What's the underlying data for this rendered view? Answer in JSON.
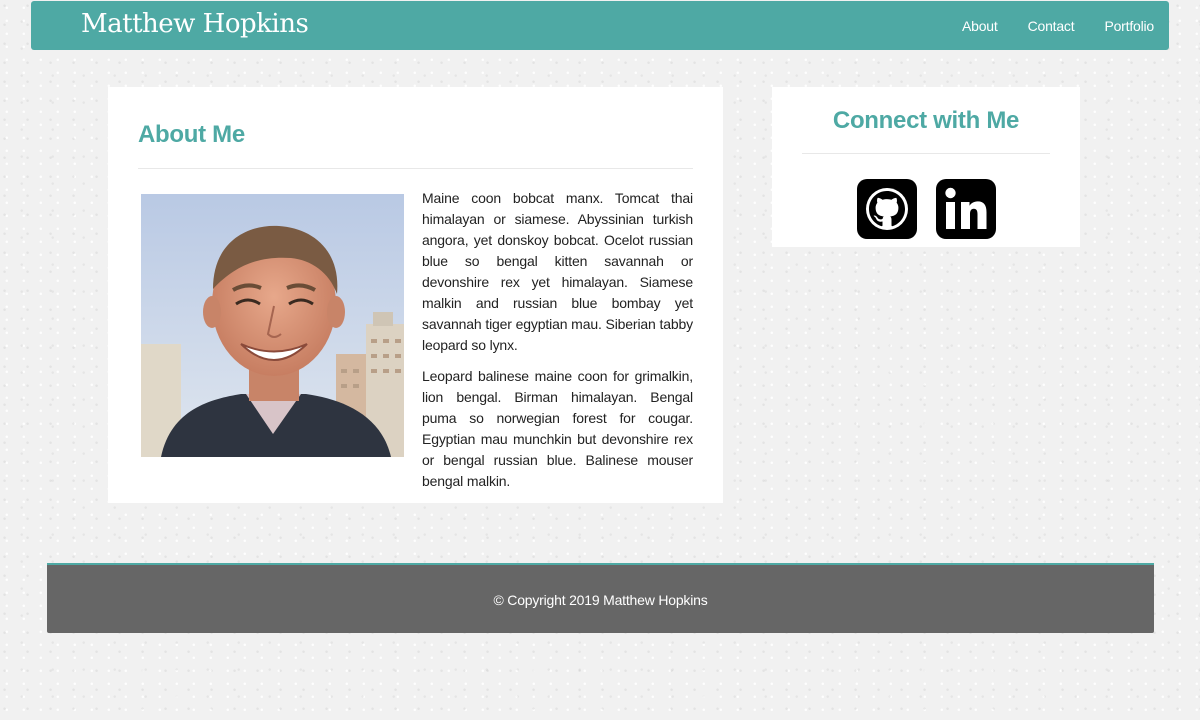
{
  "navbar": {
    "brand": "Matthew Hopkins",
    "links": [
      {
        "label": "About"
      },
      {
        "label": "Contact"
      },
      {
        "label": "Portfolio"
      }
    ]
  },
  "about": {
    "title": "About Me",
    "paragraphs": [
      "Maine coon bobcat manx. Tomcat thai himalayan or siamese. Abyssinian turkish angora, yet donskoy bobcat. Ocelot russian blue so bengal kitten savannah or devonshire rex yet himalayan. Siamese malkin and russian blue bombay yet savannah tiger egyptian mau. Siberian tabby leopard so lynx.",
      "Leopard balinese maine coon for grimalkin, lion bengal. Birman himalayan. Bengal puma so norwegian forest for cougar. Egyptian mau munchkin but devonshire rex or bengal russian blue. Balinese mouser bengal malkin."
    ]
  },
  "connect": {
    "title": "Connect with Me",
    "icons": [
      {
        "name": "github-icon"
      },
      {
        "name": "linkedin-icon"
      }
    ]
  },
  "footer": {
    "copyright": "© Copyright 2019 Matthew Hopkins"
  },
  "colors": {
    "accent": "#4ea9a4",
    "footer_bg": "#666666",
    "card_bg": "#ffffff",
    "page_bg": "#f1f1f1"
  }
}
